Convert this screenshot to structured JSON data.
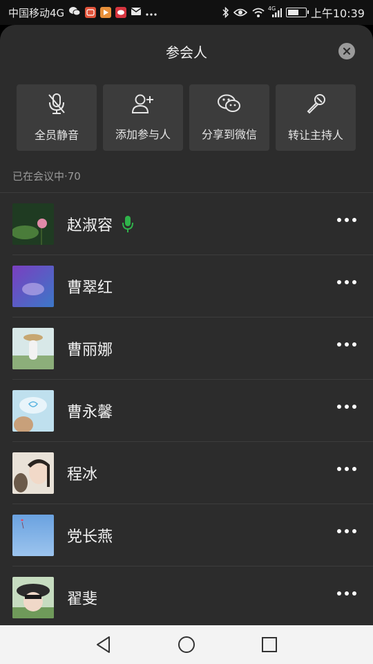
{
  "status_bar": {
    "carrier": "中国移动4G",
    "time": "上午10:39",
    "network_badge": "4G",
    "battery_level": 0.55,
    "icons": [
      "wechat-icon",
      "app-icon",
      "video-icon",
      "chat-icon",
      "mail-icon",
      "more-icon",
      "bluetooth-icon",
      "eye-icon",
      "wifi-icon",
      "signal-icon",
      "battery-icon"
    ]
  },
  "sheet": {
    "title": "参会人",
    "actions": [
      {
        "label": "全员静音",
        "icon": "mic-off-icon"
      },
      {
        "label": "添加参与人",
        "icon": "add-user-icon"
      },
      {
        "label": "分享到微信",
        "icon": "wechat-icon"
      },
      {
        "label": "转让主持人",
        "icon": "mic-icon"
      }
    ],
    "section_label": "已在会议中·70",
    "participants": [
      {
        "name": "赵淑容",
        "speaking": true,
        "avatar_colors": [
          "#1f3b22",
          "#4a7c3a"
        ]
      },
      {
        "name": "曹翠红",
        "speaking": false,
        "avatar_colors": [
          "#5b3fa8",
          "#3c78c8"
        ]
      },
      {
        "name": "曹丽娜",
        "speaking": false,
        "avatar_colors": [
          "#d8e8e8",
          "#8cae7a"
        ]
      },
      {
        "name": "曹永馨",
        "speaking": false,
        "avatar_colors": [
          "#bfe0ee",
          "#9cb8c6"
        ]
      },
      {
        "name": "程冰",
        "speaking": false,
        "avatar_colors": [
          "#e9e2d8",
          "#6b5a4a"
        ]
      },
      {
        "name": "党长燕",
        "speaking": false,
        "avatar_colors": [
          "#7fb0e6",
          "#5d95d2"
        ]
      },
      {
        "name": "翟斐",
        "speaking": false,
        "avatar_colors": [
          "#9fc59a",
          "#2b2b2b"
        ]
      }
    ]
  },
  "colors": {
    "accent_green": "#2fb34a",
    "sheet_bg": "#2c2c2c",
    "button_bg": "#3c3c3c"
  }
}
